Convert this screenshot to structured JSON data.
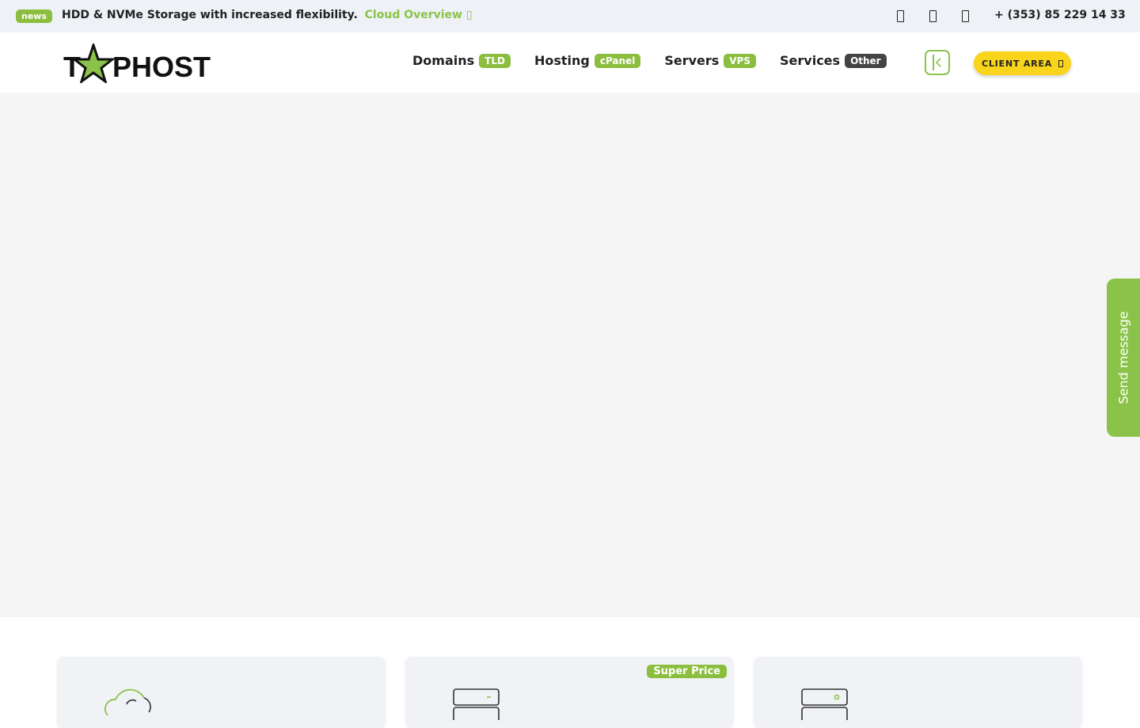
{
  "topbar": {
    "badge": "news",
    "message": "HDD & NVMe Storage with increased flexibility.",
    "link": "Cloud Overview",
    "link_icon": "",
    "icons": [
      "mobile-icon-1",
      "mobile-icon-2",
      "mobile-icon-3"
    ],
    "phone": "+ (353) 85 229 14 33"
  },
  "header": {
    "logo": "TOPHOST",
    "nav": [
      {
        "label": "Domains",
        "badge": "TLD"
      },
      {
        "label": "Hosting",
        "badge": "cPanel"
      },
      {
        "label": "Servers",
        "badge": "VPS"
      },
      {
        "label": "Services",
        "badge": "Other"
      }
    ],
    "client_area": "CLIENT AREA"
  },
  "side_tab": {
    "label": "Send message"
  },
  "cards": [
    {
      "icon": "cloud-icon",
      "badge": ""
    },
    {
      "icon": "server-icon",
      "badge": "Super Price"
    },
    {
      "icon": "server-icon",
      "badge": ""
    }
  ],
  "colors": {
    "accent": "#8bc34a",
    "client_button": "#f9d41c",
    "topbar_bg": "#eef1f6"
  }
}
